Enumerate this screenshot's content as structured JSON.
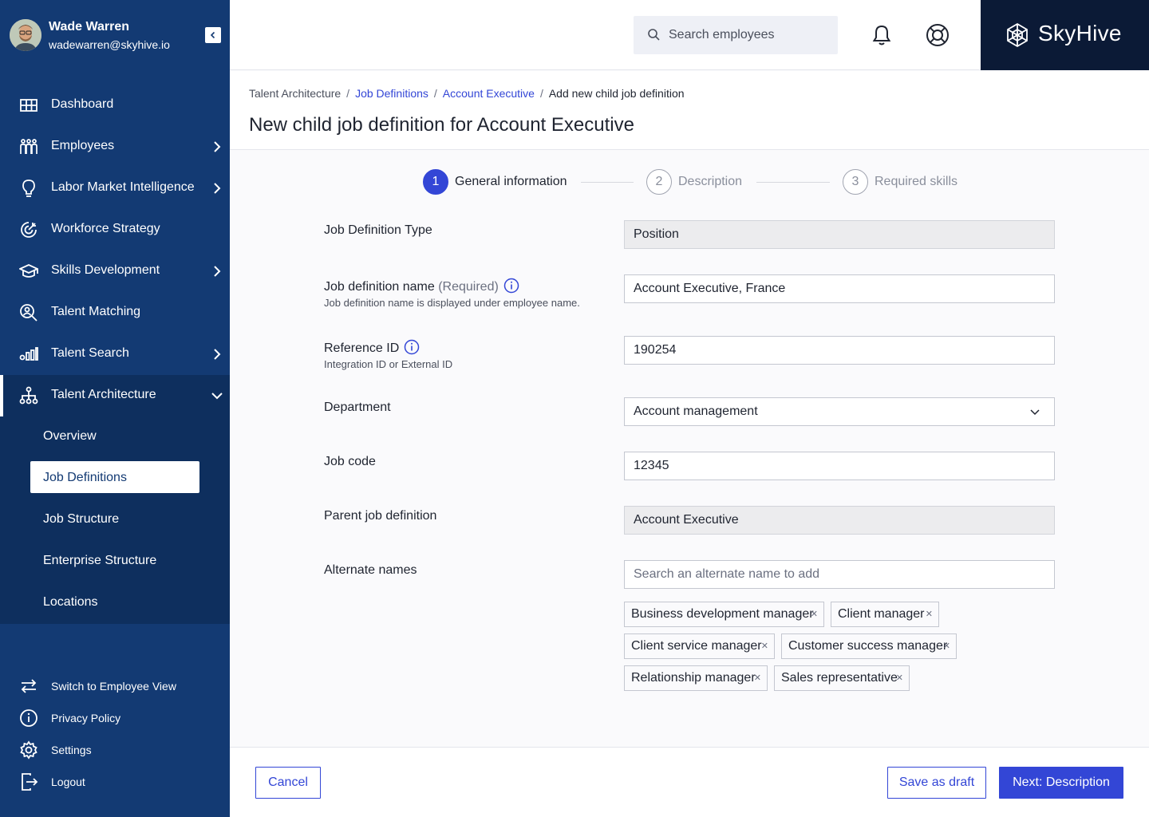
{
  "user": {
    "name": "Wade Warren",
    "email": "wadewarren@skyhive.io"
  },
  "sidebar": {
    "items": [
      {
        "label": "Dashboard",
        "icon": "dashboard-grid-icon"
      },
      {
        "label": "Employees",
        "icon": "employees-icon"
      },
      {
        "label": "Labor Market Intelligence",
        "icon": "lightbulb-icon"
      },
      {
        "label": "Workforce Strategy",
        "icon": "target-icon"
      },
      {
        "label": "Skills Development",
        "icon": "graduation-cap-icon"
      },
      {
        "label": "Talent Matching",
        "icon": "person-search-icon"
      },
      {
        "label": "Talent Search",
        "icon": "bar-search-icon"
      },
      {
        "label": "Talent Architecture",
        "icon": "hierarchy-icon"
      }
    ],
    "subitems": [
      "Overview",
      "Job Definitions",
      "Job Structure",
      "Enterprise Structure",
      "Locations"
    ],
    "bottom": [
      {
        "label": "Switch to Employee View",
        "icon": "switch-icon"
      },
      {
        "label": "Privacy Policy",
        "icon": "info-icon"
      },
      {
        "label": "Settings",
        "icon": "gear-icon"
      },
      {
        "label": "Logout",
        "icon": "logout-icon"
      }
    ]
  },
  "header": {
    "search_placeholder": "Search employees",
    "brand": "SkyHive"
  },
  "breadcrumb": {
    "items": [
      "Talent Architecture",
      "Job Definitions",
      "Account Executive",
      "Add new child job definition"
    ]
  },
  "page": {
    "title": "New child job definition for Account Executive"
  },
  "stepper": {
    "steps": [
      {
        "num": "1",
        "label": "General information"
      },
      {
        "num": "2",
        "label": "Description"
      },
      {
        "num": "3",
        "label": "Required skills"
      }
    ]
  },
  "form": {
    "type": {
      "label": "Job Definition Type",
      "value": "Position"
    },
    "name": {
      "label": "Job definition name",
      "required": "(Required)",
      "help": "Job definition name is displayed under employee name.",
      "value": "Account Executive, France"
    },
    "ref": {
      "label": "Reference ID",
      "help": "Integration ID or External ID",
      "value": "190254"
    },
    "department": {
      "label": "Department",
      "value": "Account management"
    },
    "jobcode": {
      "label": "Job code",
      "value": "12345"
    },
    "parent": {
      "label": "Parent job definition",
      "value": "Account Executive"
    },
    "alternate": {
      "label": "Alternate names",
      "placeholder": "Search an alternate name to add",
      "tags": [
        "Business development manager",
        "Client manager",
        "Client service manager",
        "Customer success manager",
        "Relationship manager",
        "Sales representative"
      ]
    }
  },
  "footer": {
    "cancel": "Cancel",
    "draft": "Save as draft",
    "next": "Next: Description"
  },
  "colors": {
    "sidebar": "#133a73",
    "sidebar_active": "#0e2f5e",
    "accent": "#3346d6",
    "brand_bg": "#0b1a36"
  }
}
